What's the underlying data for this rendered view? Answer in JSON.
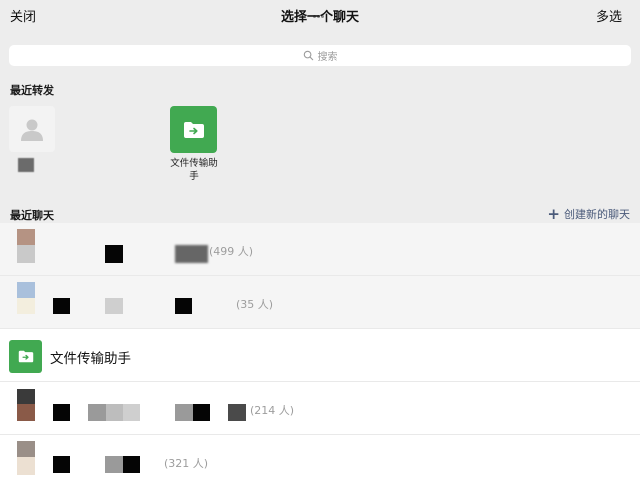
{
  "topbar": {
    "close_label": "关闭",
    "title": "选择一个聊天",
    "multi_select_label": "多选"
  },
  "search": {
    "placeholder": "搜索",
    "icon": "search-icon"
  },
  "recent_forward": {
    "label": "最近转发",
    "items": [
      {
        "kind": "person",
        "icon": "default-avatar-icon"
      },
      {
        "kind": "file-helper",
        "name": "文件传输助手",
        "icon": "folder-arrow-icon",
        "color": "#41a951"
      }
    ]
  },
  "recent_chats": {
    "label": "最近聊天",
    "create_label": "创建新的聊天",
    "create_icon": "plus-icon",
    "items": [
      {
        "kind": "group",
        "member_count": "(499 人)"
      },
      {
        "kind": "group",
        "member_count": "(35 人)"
      },
      {
        "kind": "file-helper",
        "name": "文件传输助手",
        "icon": "folder-arrow-icon"
      },
      {
        "kind": "group",
        "member_count": "(214 人)"
      },
      {
        "kind": "group",
        "member_count": "(321 人)"
      }
    ]
  },
  "colors": {
    "background": "#ededed",
    "accent_green": "#41a951",
    "link": "#4a5a7a",
    "muted": "#9d9d9d"
  }
}
